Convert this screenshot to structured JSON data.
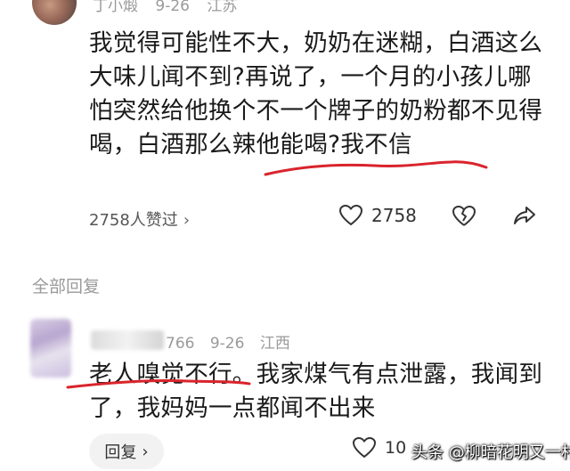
{
  "top_comment": {
    "author": "丁小煅",
    "date": "9-26",
    "location": "江苏",
    "text": "我觉得可能性不大，奶奶在迷糊，白酒这么大味儿闻不到?再说了，一个月的小孩儿哪怕突然给他换个不一个牌子的奶粉都不见得喝，白酒那么辣他能喝?我不信",
    "likes_link": "2758人赞过",
    "like_count": "2758"
  },
  "replies_section": {
    "title": "全部回复"
  },
  "reply": {
    "author_suffix": "766",
    "date": "9-26",
    "location": "江西",
    "text": "老人嗅觉不行。我家煤气有点泄露，我闻到了，我妈妈一点都闻不出来",
    "reply_label": "回复",
    "like_count": "10"
  },
  "watermark": "头条 @柳暗花明又一村",
  "colors": {
    "underline": "#d9242c",
    "muted": "#9a9a9a",
    "text": "#1a1a1a"
  }
}
